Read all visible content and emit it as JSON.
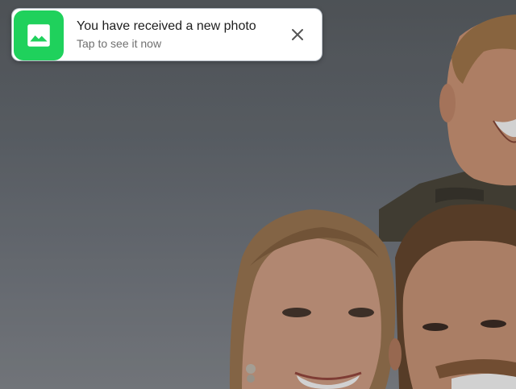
{
  "notification": {
    "title": "You have received a new photo",
    "subtitle": "Tap to see it now",
    "app_icon": "image-icon",
    "close_icon": "close-icon",
    "accent_color": "#1fd15c"
  },
  "background": {
    "type": "photo",
    "subject": "smiling family",
    "sky_color": "#6a7077"
  }
}
